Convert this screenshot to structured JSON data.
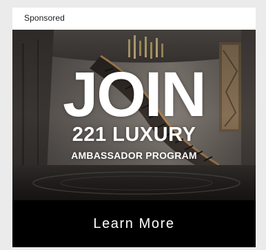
{
  "ad": {
    "sponsored_label": "Sponsored",
    "headline": "JOIN",
    "subheadline": "221 LUXURY",
    "tagline": "AMBASSADOR PROGRAM",
    "cta_label": "Learn More"
  },
  "colors": {
    "page_background": "#ebebeb",
    "card_background": "#ffffff",
    "cta_background": "#000000",
    "cta_text": "#ffffff",
    "hero_text": "#ffffff"
  }
}
